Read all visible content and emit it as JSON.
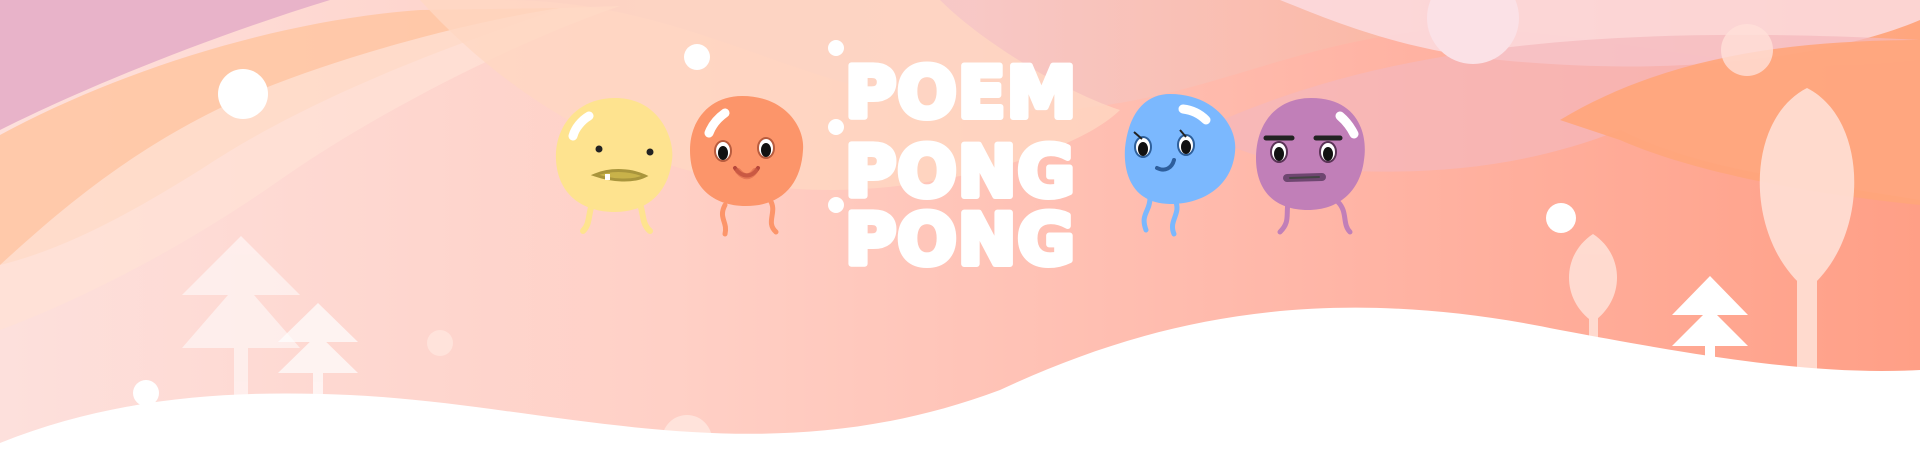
{
  "banner": {
    "title_lines": [
      "POEM",
      "PONG",
      "PONG"
    ]
  },
  "characters": [
    {
      "name": "yellow-character",
      "color": "#FEE38F",
      "accent": "#E8C75A",
      "mouth": "#C8B24A"
    },
    {
      "name": "orange-character",
      "color": "#FC956A",
      "accent": "#E67B52",
      "mouth": "#D7664A"
    },
    {
      "name": "blue-character",
      "color": "#7BB8FE",
      "accent": "#5A9BE3",
      "mouth": "#3E7DC7"
    },
    {
      "name": "purple-character",
      "color": "#C17FB8",
      "accent": "#A065A0",
      "mouth": "#6E4670"
    }
  ],
  "colors": {
    "sky_left": "#E9B7C8",
    "sky_right": "#FFA87C",
    "ground": "#FFFFFF",
    "tree": "#FFFFFF"
  }
}
